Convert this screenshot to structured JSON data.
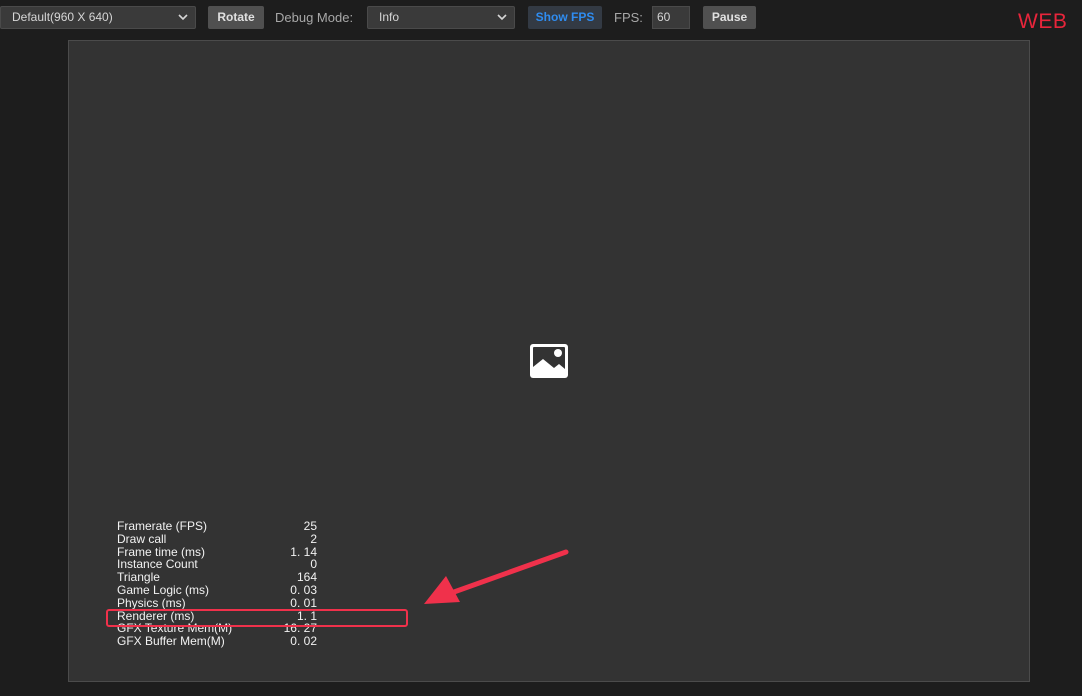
{
  "toolbar": {
    "resolution_select": "Default(960 X 640)",
    "rotate_label": "Rotate",
    "debug_mode_label": "Debug Mode:",
    "debug_mode_select": "Info",
    "show_fps_label": "Show FPS",
    "fps_label": "FPS:",
    "fps_value": "60",
    "pause_label": "Pause",
    "platform_tag": "WEB"
  },
  "colors": {
    "accent_blue": "#2f8cf0",
    "annotation_red": "#f0314b"
  },
  "icons": {
    "placeholder": "image-placeholder-icon",
    "dropdown": "chevron-down-icon"
  },
  "stats": [
    {
      "label": "Framerate (FPS)",
      "value": "25"
    },
    {
      "label": "Draw call",
      "value": "2"
    },
    {
      "label": "Frame time (ms)",
      "value": "1. 14"
    },
    {
      "label": "Instance Count",
      "value": "0"
    },
    {
      "label": "Triangle",
      "value": "164"
    },
    {
      "label": "Game Logic (ms)",
      "value": "0. 03"
    },
    {
      "label": "Physics (ms)",
      "value": "0. 01"
    },
    {
      "label": "Renderer (ms)",
      "value": "1. 1"
    },
    {
      "label": "GFX Texture Mem(M)",
      "value": "16. 27"
    },
    {
      "label": "GFX Buffer Mem(M)",
      "value": "0. 02"
    }
  ]
}
